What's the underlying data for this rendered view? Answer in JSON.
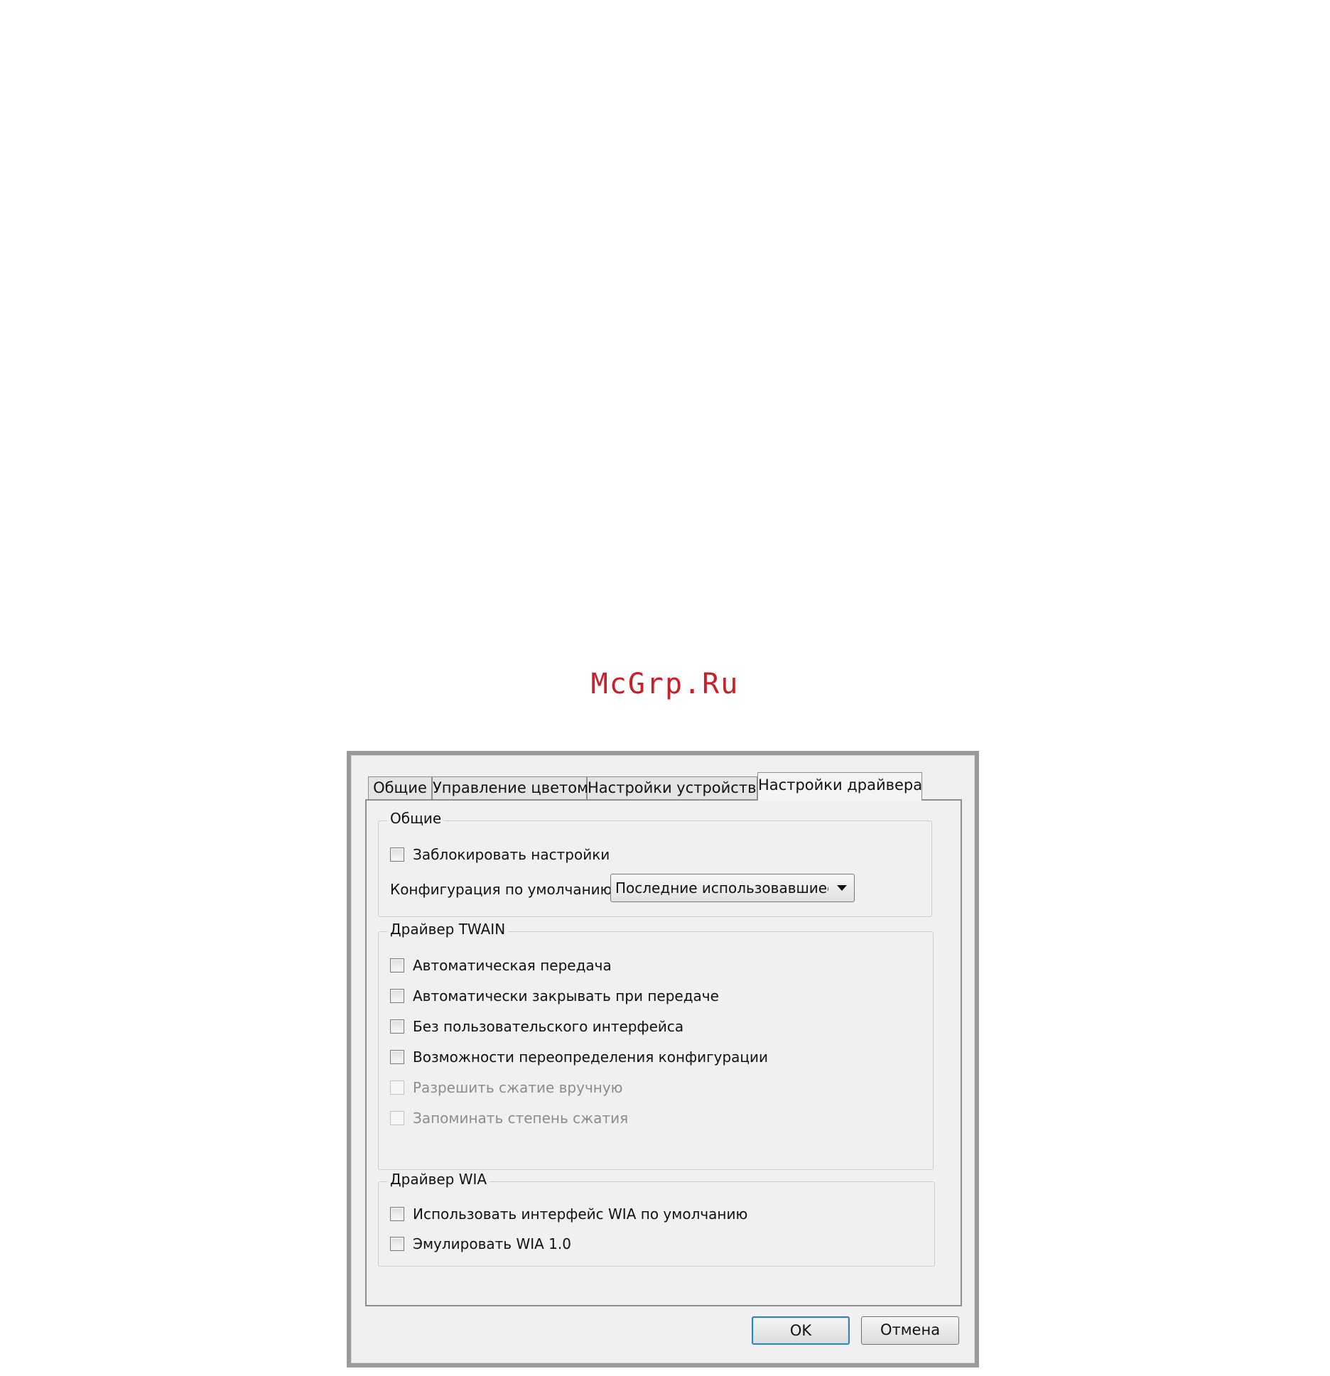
{
  "watermark": "McGrp.Ru",
  "tabs": [
    {
      "label": "Общие"
    },
    {
      "label": "Управление цветом"
    },
    {
      "label": "Настройки устройства"
    },
    {
      "label": "Настройки драйвера"
    }
  ],
  "active_tab": "Настройки драйвера",
  "general": {
    "title": "Общие",
    "lock_settings": {
      "label": "Заблокировать настройки",
      "checked": false
    },
    "default_config_label": "Конфигурация по умолчанию:",
    "default_config_value": "Последние использовавшиеся параметры"
  },
  "twain": {
    "title": "Драйвер TWAIN",
    "items": [
      {
        "label": "Автоматическая передача",
        "checked": false,
        "enabled": true
      },
      {
        "label": "Автоматически закрывать при передаче",
        "checked": false,
        "enabled": true
      },
      {
        "label": "Без пользовательского интерфейса",
        "checked": false,
        "enabled": true
      },
      {
        "label": "Возможности переопределения конфигурации",
        "checked": false,
        "enabled": true
      },
      {
        "label": "Разрешить сжатие вручную",
        "checked": false,
        "enabled": false
      },
      {
        "label": "Запоминать степень сжатия",
        "checked": false,
        "enabled": false
      }
    ]
  },
  "wia": {
    "title": "Драйвер WIA",
    "items": [
      {
        "label": "Использовать интерфейс WIA по умолчанию",
        "checked": false,
        "enabled": true
      },
      {
        "label": "Эмулировать WIA 1.0",
        "checked": false,
        "enabled": true
      }
    ]
  },
  "buttons": {
    "ok": "OK",
    "cancel": "Отмена"
  }
}
